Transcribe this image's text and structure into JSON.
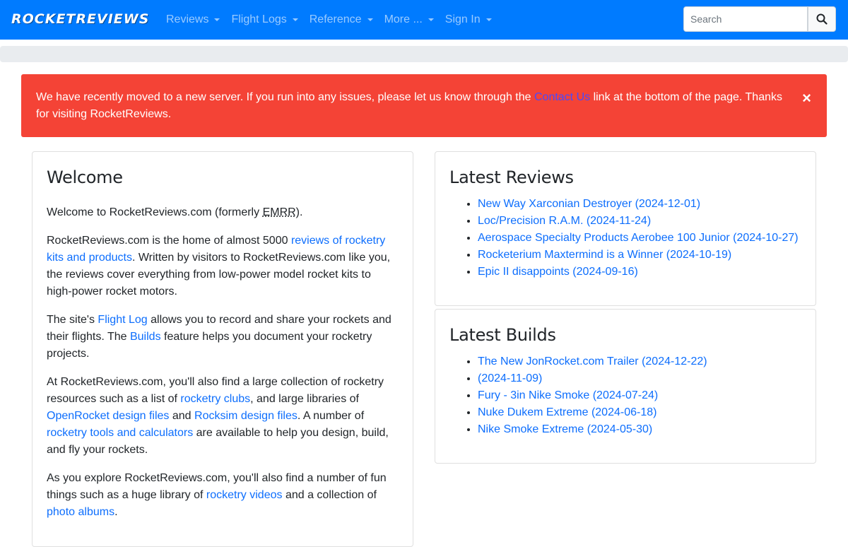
{
  "navbar": {
    "brand": "ROCKETREVIEWS",
    "menu": [
      {
        "label": "Reviews"
      },
      {
        "label": "Flight Logs"
      },
      {
        "label": "Reference"
      },
      {
        "label": "More ..."
      },
      {
        "label": "Sign In"
      }
    ],
    "search_placeholder": "Search",
    "search_icon": "search-icon"
  },
  "alert": {
    "text_before": "We have recently moved to a new server. If you run into any issues, please let us know through the ",
    "link": "Contact Us",
    "text_after": " link at the bottom of the page. Thanks for visiting RocketReviews.",
    "close": "×"
  },
  "welcome": {
    "title": "Welcome",
    "p1_a": "Welcome to RocketReviews.com (formerly ",
    "p1_abbr": "EMRR",
    "p1_b": ").",
    "p2_a": "RocketReviews.com is the home of almost 5000 ",
    "p2_link": "reviews of rocketry kits and products",
    "p2_b": ". Written by visitors to RocketReviews.com like you, the reviews cover everything from low-power model rocket kits to high-power rocket motors.",
    "p3_a": "The site's ",
    "p3_link1": "Flight Log",
    "p3_b": " allows you to record and share your rockets and their flights.  The ",
    "p3_link2": "Builds",
    "p3_c": " feature helps you document your rocketry projects.",
    "p4_a": "At RocketReviews.com, you'll also find a large collection of rocketry resources such as a list of ",
    "p4_link1": "rocketry clubs",
    "p4_b": ", and large libraries of ",
    "p4_link2": "OpenRocket design files",
    "p4_c": " and ",
    "p4_link3": "Rocksim design files",
    "p4_d": ". A number of ",
    "p4_link4": "rocketry tools and calculators",
    "p4_e": " are available to help you design, build, and fly your rockets.",
    "p5_a": "As you explore RocketReviews.com, you'll also find a number of fun things such as a huge library of ",
    "p5_link1": "rocketry videos",
    "p5_b": " and a collection of ",
    "p5_link2": "photo albums",
    "p5_c": "."
  },
  "latest_reviews": {
    "title": "Latest Reviews",
    "items": [
      "New Way Xarconian Destroyer (2024-12-01)",
      "Loc/Precision R.A.M. (2024-11-24)",
      "Aerospace Specialty Products Aerobee 100 Junior (2024-10-27)",
      "Rocketerium Maxtermind is a Winner (2024-10-19)",
      "Epic II disappoints (2024-09-16)"
    ]
  },
  "latest_builds": {
    "title": "Latest Builds",
    "items": [
      "The New JonRocket.com Trailer (2024-12-22)",
      "(2024-11-09)",
      "Fury - 3in Nike Smoke (2024-07-24)",
      "Nuke Dukem Extreme (2024-06-18)",
      "Nike Smoke Extreme (2024-05-30)"
    ]
  }
}
